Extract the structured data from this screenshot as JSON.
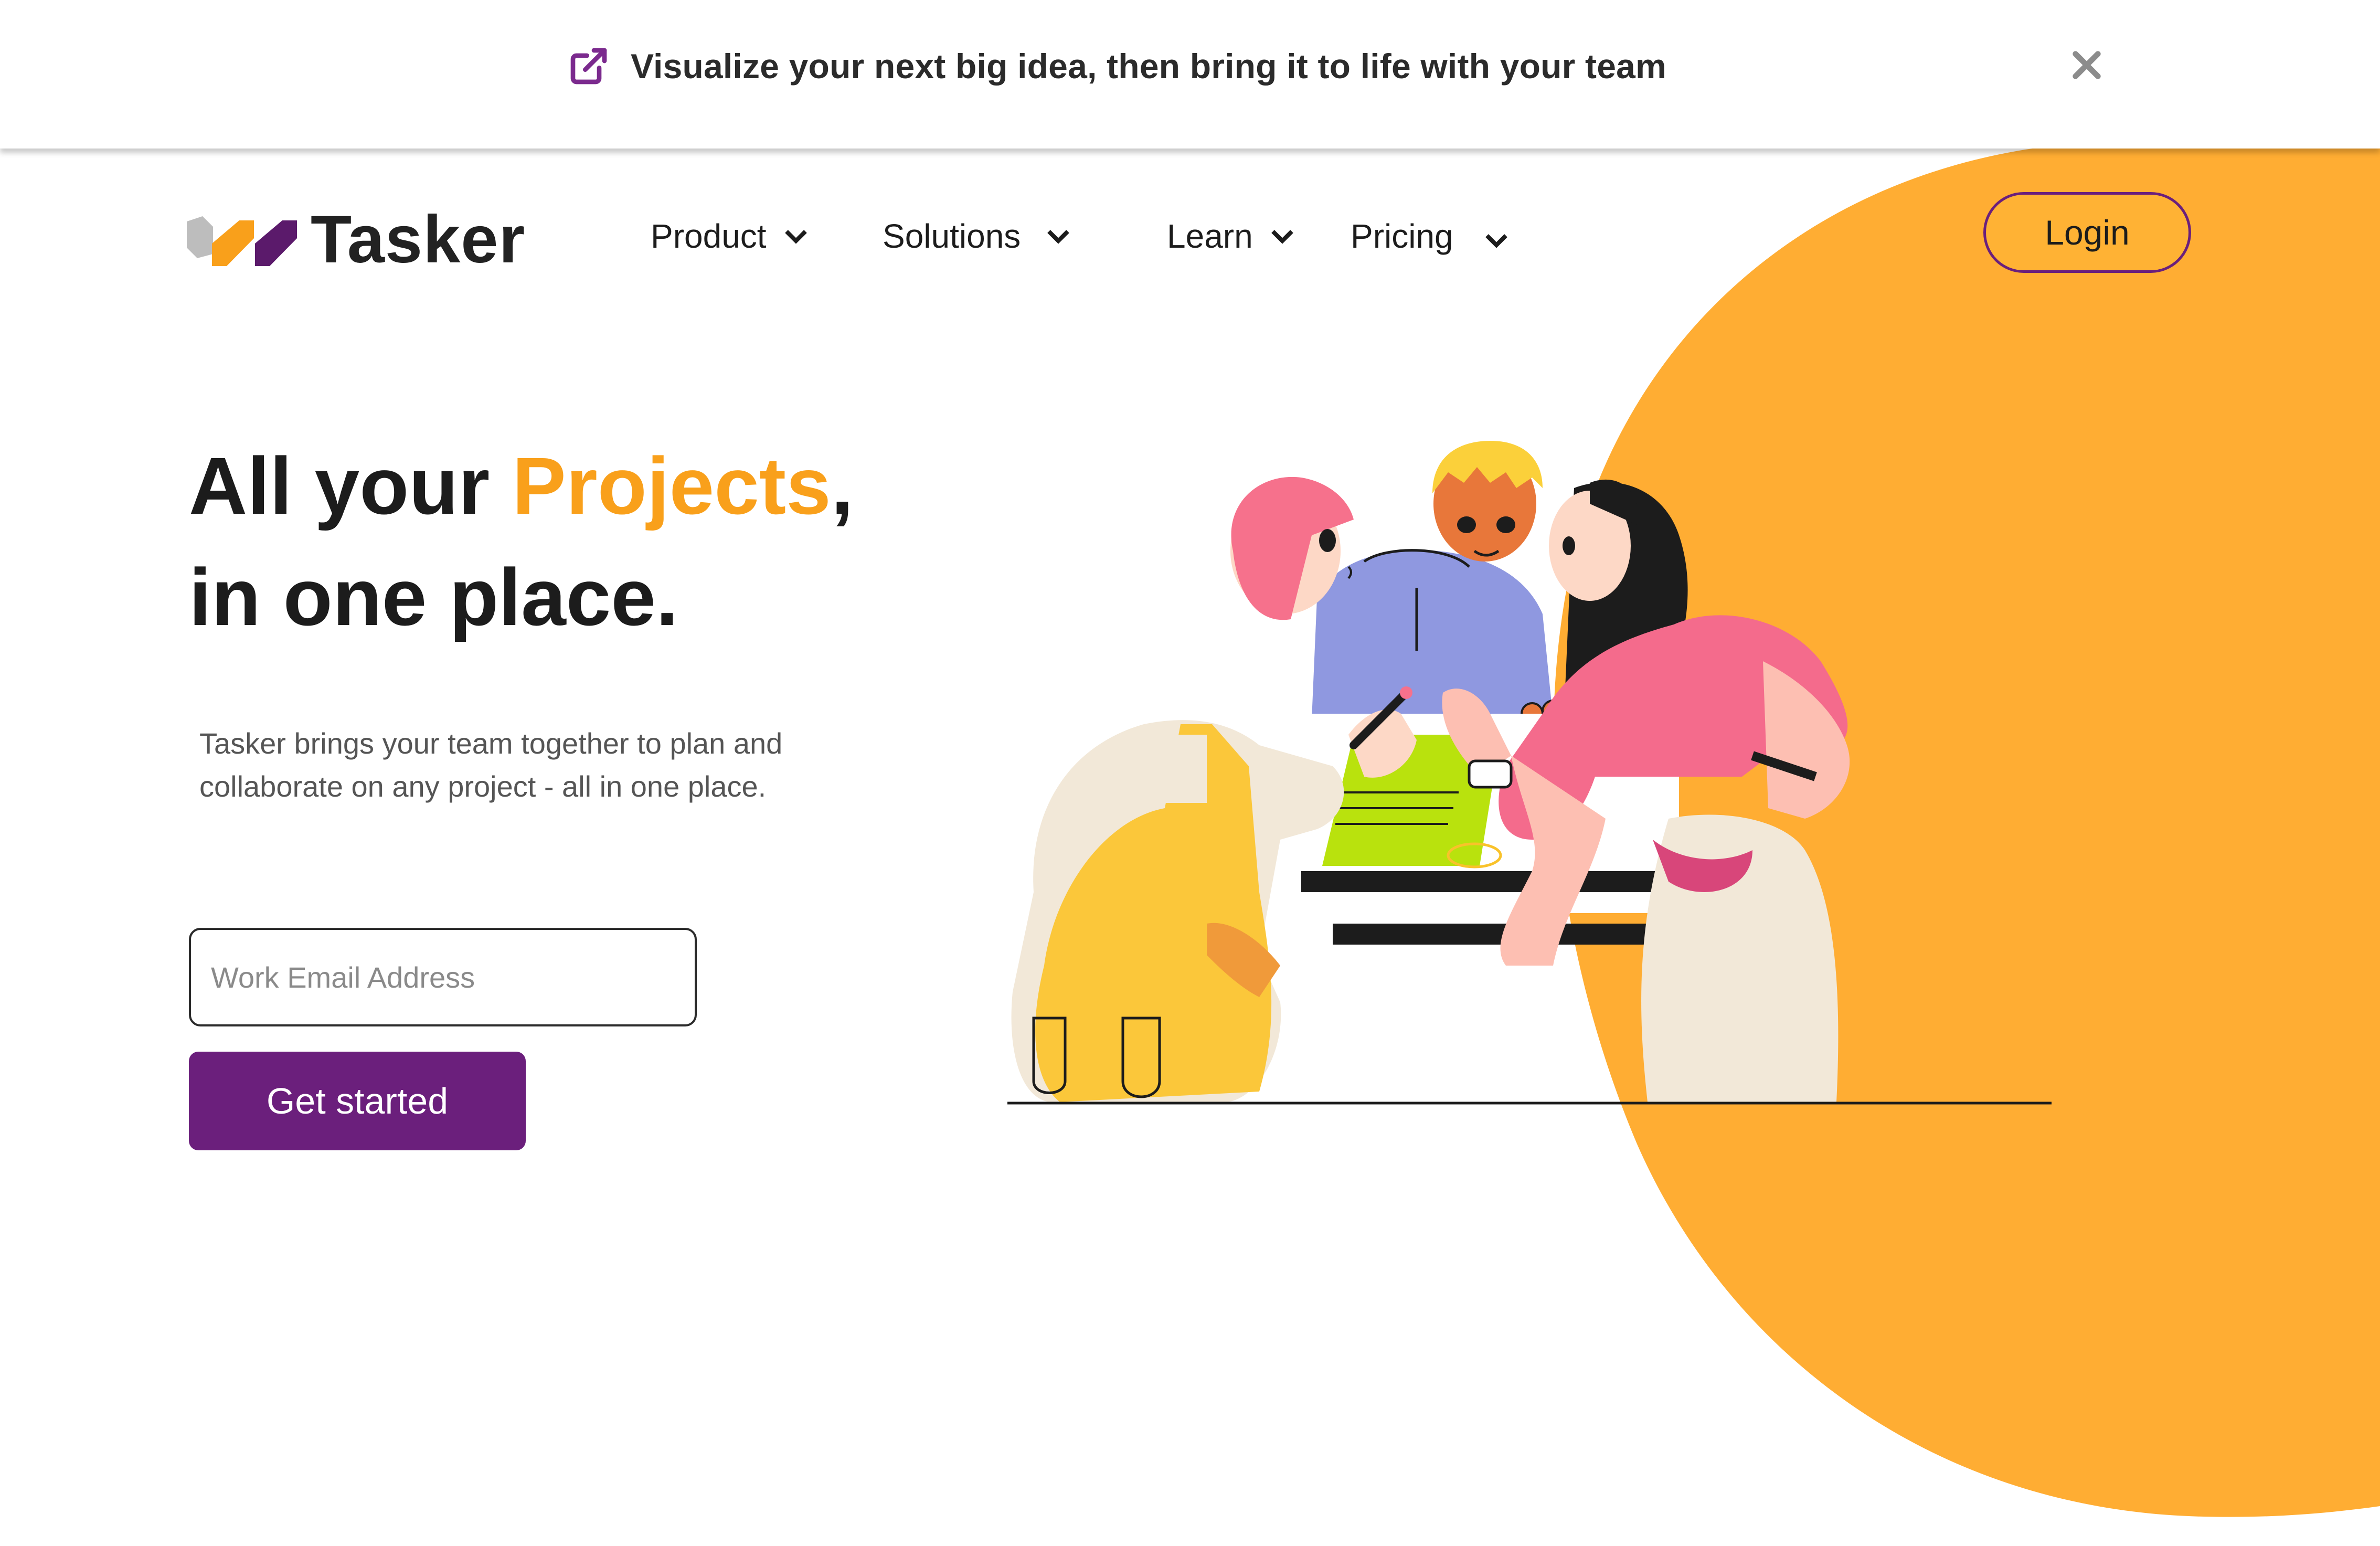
{
  "announcement": {
    "icon": "external-link-icon",
    "text": "Visualize your next big idea, then bring it to life with your team",
    "close_icon": "close-icon"
  },
  "header": {
    "logo_text": "Tasker",
    "nav": [
      {
        "label": "Product",
        "icon": "chevron-down-icon"
      },
      {
        "label": "Solutions",
        "icon": "chevron-down-icon"
      },
      {
        "label": "Learn",
        "icon": "chevron-down-icon"
      },
      {
        "label": "Pricing",
        "icon": "chevron-down-icon"
      }
    ],
    "login_label": "Login"
  },
  "hero": {
    "title_part1": "All your ",
    "title_accent": "Projects",
    "title_part2": ",",
    "title_line2": "in one place.",
    "subtitle": "Tasker brings your team together to plan and collaborate on any project - all in one place.",
    "email_placeholder": "Work Email Address",
    "cta_label": "Get started"
  },
  "colors": {
    "brand_purple": "#6b1f7c",
    "accent_orange": "#f9a01b",
    "blob_orange": "#ffad33"
  }
}
